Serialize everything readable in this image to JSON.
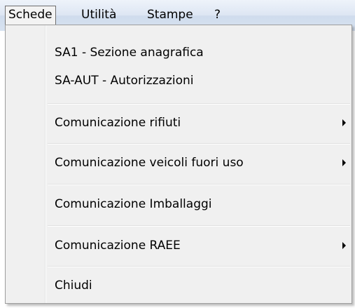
{
  "menubar": {
    "items": [
      {
        "label": "Schede"
      },
      {
        "label": "Utilità"
      },
      {
        "label": "Stampe"
      },
      {
        "label": "?"
      }
    ]
  },
  "dropdown": {
    "items": [
      {
        "label": "SA1 - Sezione anagrafica",
        "has_submenu": false
      },
      {
        "label": "SA-AUT - Autorizzazioni",
        "has_submenu": false
      },
      {
        "label": "Comunicazione rifiuti",
        "has_submenu": true
      },
      {
        "label": "Comunicazione veicoli fuori uso",
        "has_submenu": true
      },
      {
        "label": "Comunicazione Imballaggi",
        "has_submenu": false
      },
      {
        "label": "Comunicazione RAEE",
        "has_submenu": true
      },
      {
        "label": "Chiudi",
        "has_submenu": false
      }
    ]
  }
}
